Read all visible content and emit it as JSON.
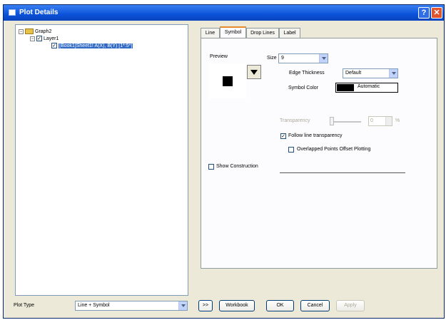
{
  "window": {
    "title": "Plot Details"
  },
  "tree": {
    "graph": {
      "expander": "−",
      "label": "Graph2"
    },
    "layer": {
      "expander": "−",
      "check": "✓",
      "label": "Layer1"
    },
    "plot": {
      "check": "✓",
      "label": "[Book1]Sheet1! A(X), B(Y) [1*:5*]"
    }
  },
  "tabs": [
    {
      "label": "Line"
    },
    {
      "label": "Symbol"
    },
    {
      "label": "Drop Lines"
    },
    {
      "label": "Label"
    }
  ],
  "symbol": {
    "preview_label": "Preview",
    "size_label": "Size",
    "size_value": "9",
    "edge_label": "Edge Thickness",
    "edge_value": "Default",
    "color_label": "Symbol Color",
    "color_value": "Automatic",
    "transparency_label": "Transparency",
    "transparency_value": "0",
    "transparency_unit": "%",
    "follow_label": "Follow line transparency",
    "follow_check": "✓",
    "overlap_label": "Overlapped Points Offset Plotting",
    "construction_label": "Show Construction"
  },
  "bottom": {
    "plot_type_label": "Plot Type",
    "plot_type_value": "Line + Symbol",
    "expand_label": ">>",
    "workbook_label": "Workbook",
    "ok_label": "OK",
    "cancel_label": "Cancel",
    "apply_label": "Apply"
  },
  "colors": {
    "titlebar": "#0a52d8",
    "selection": "#316ac5",
    "active_tab": "#e68b2c"
  }
}
